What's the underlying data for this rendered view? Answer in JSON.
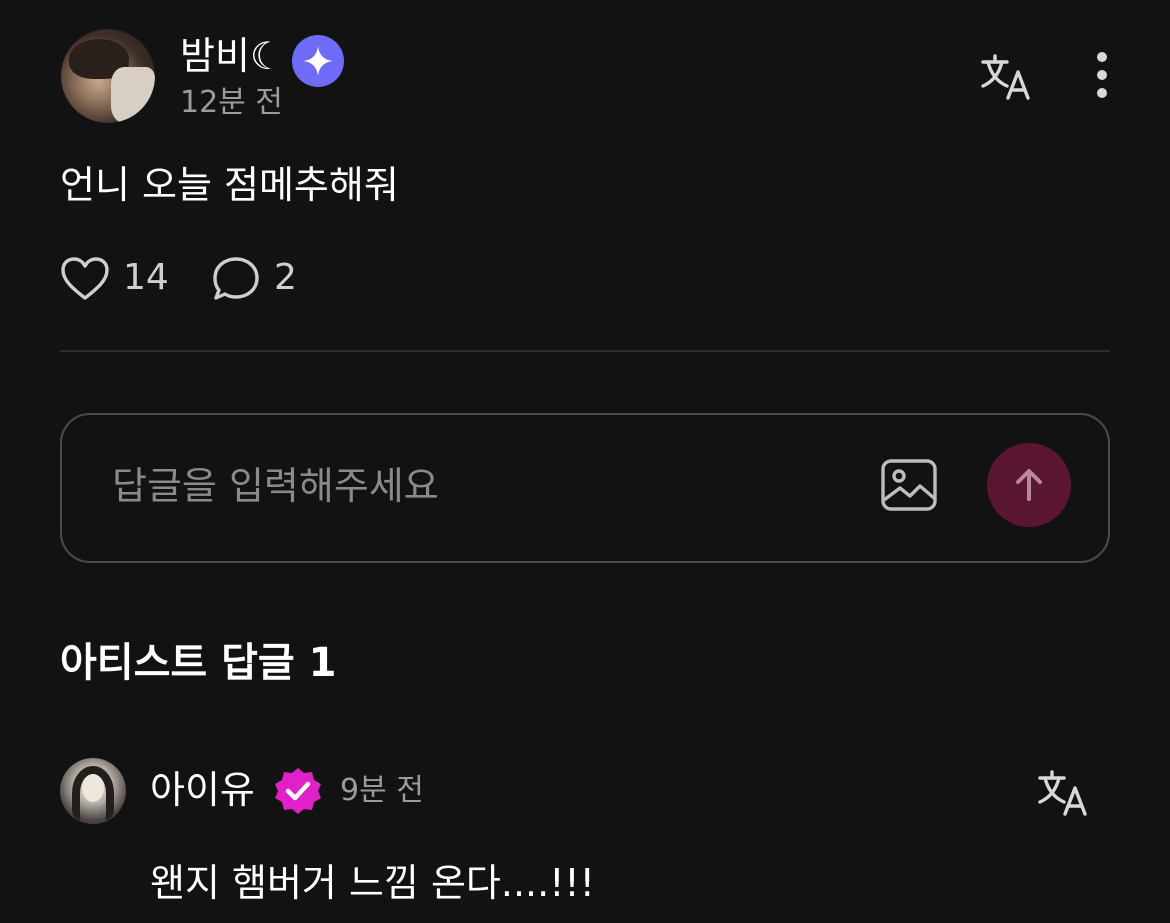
{
  "post": {
    "author": "밤비☾",
    "time": "12분 전",
    "body": "언니 오늘 점메추해줘",
    "likes": "14",
    "comments": "2",
    "author_badge_icon": "sparkle-badge-icon"
  },
  "reply_input": {
    "placeholder": "답글을 입력해주세요"
  },
  "artist_section": {
    "title": "아티스트 답글 1"
  },
  "artist_reply": {
    "author": "아이유",
    "time": "9분 전",
    "body": "왠지 햄버거 느낌 온다....!!!"
  },
  "colors": {
    "background": "#121212",
    "badge_star": "#6e6cf6",
    "send_button": "#5a1532",
    "verified_badge": "#e020c8"
  }
}
